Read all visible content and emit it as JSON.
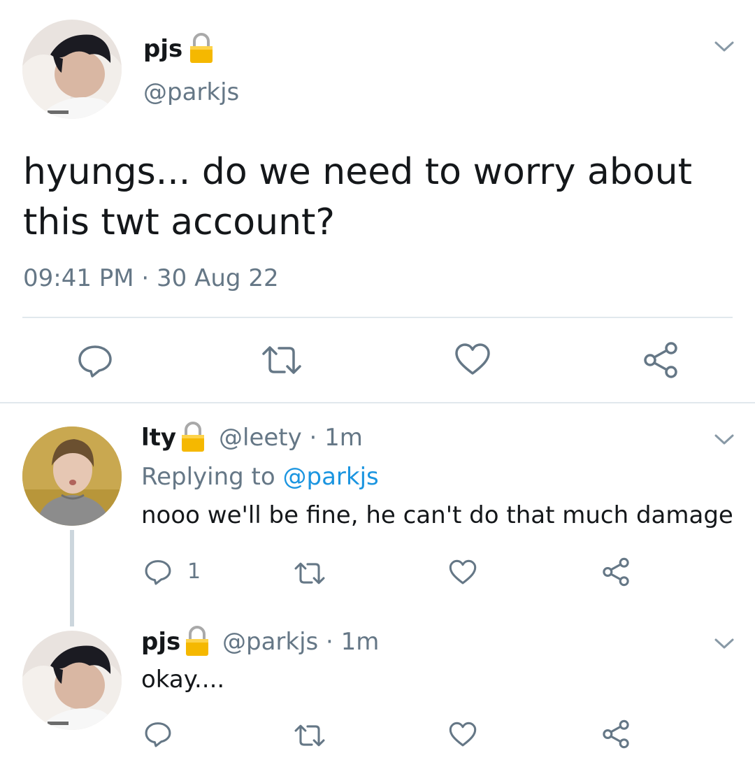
{
  "main_tweet": {
    "name": "pjs",
    "handle": "@parkjs",
    "text_line1": "hyungs... do we need to worry about",
    "text_line2": "this twt account?",
    "timestamp": "09:41 PM · 30 Aug 22",
    "protected_icon": "lock-icon",
    "menu_icon": "chevron-down-icon",
    "actions": [
      "reply-icon",
      "retweet-icon",
      "like-icon",
      "share-icon"
    ]
  },
  "replies": [
    {
      "name": "lty",
      "handle_time": "@leety · 1m",
      "replying_prefix": "Replying to ",
      "replying_to": "@parkjs",
      "text": "nooo we'll be fine, he can't do that much damage",
      "reply_count": "1",
      "protected_icon": "lock-icon",
      "menu_icon": "chevron-down-icon"
    },
    {
      "name": "pjs",
      "handle_time": "@parkjs · 1m",
      "text": "okay....",
      "reply_count": "",
      "protected_icon": "lock-icon",
      "menu_icon": "chevron-down-icon"
    }
  ],
  "colors": {
    "text": "#14171a",
    "secondary": "#657786",
    "link": "#1b95e0",
    "divider": "#e1e8ed",
    "lock": "#f5b800"
  }
}
